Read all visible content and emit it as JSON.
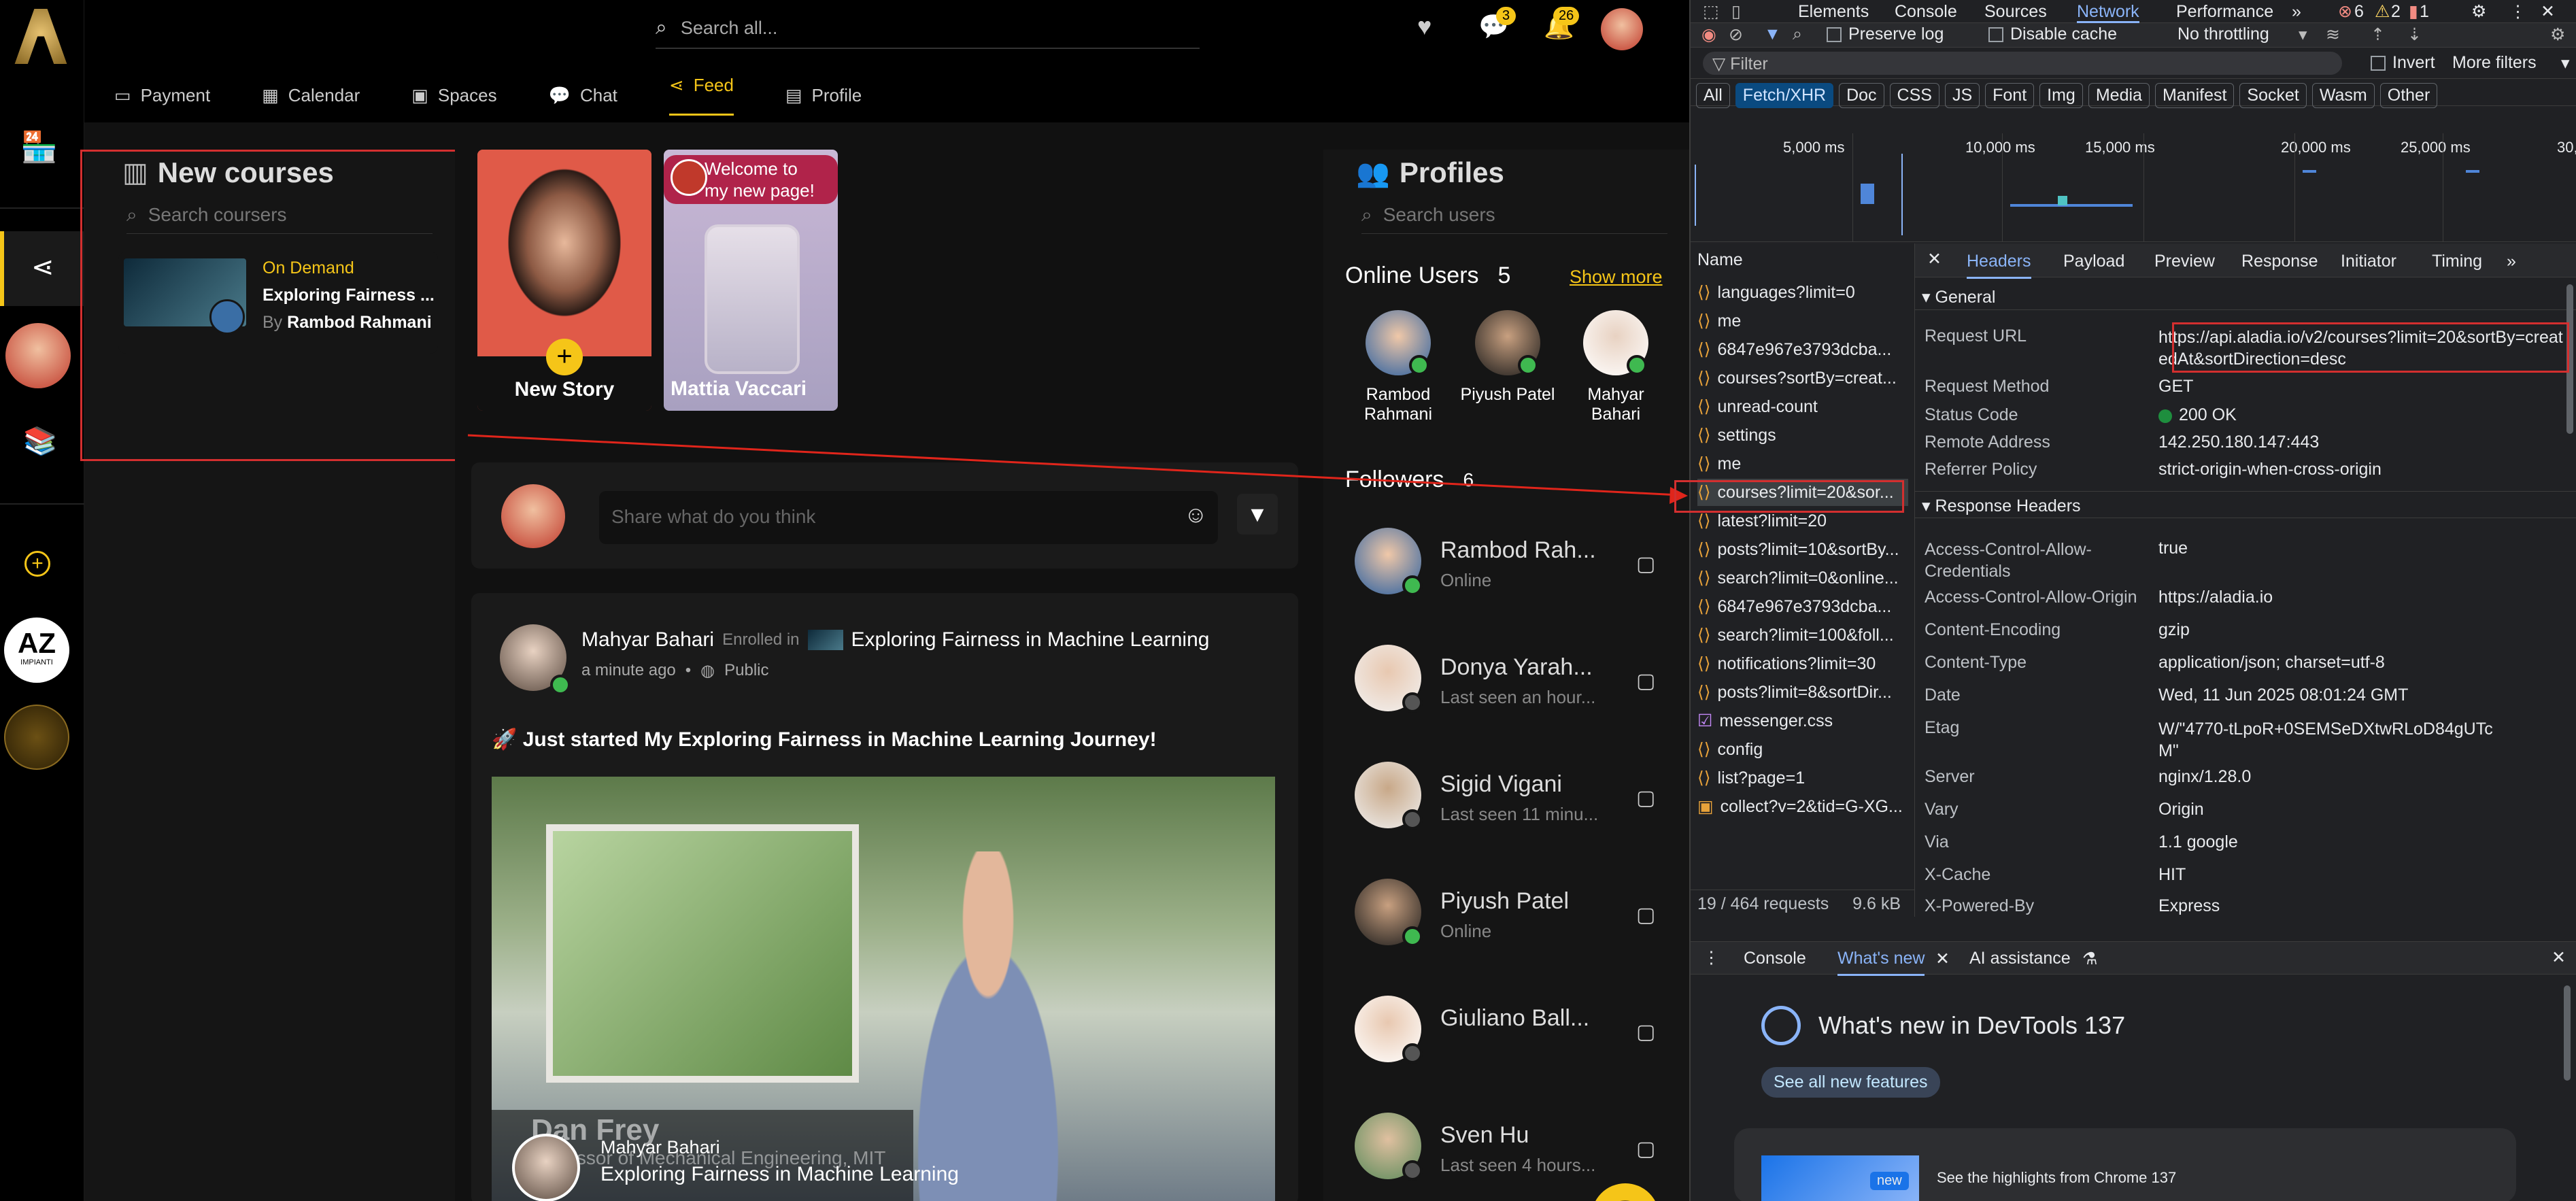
{
  "search": {
    "placeholder": "Search all..."
  },
  "header": {
    "messages_badge": "3",
    "notifications_badge": "26"
  },
  "nav": [
    {
      "label": "Payment"
    },
    {
      "label": "Calendar"
    },
    {
      "label": "Spaces"
    },
    {
      "label": "Chat"
    },
    {
      "label": "Feed"
    },
    {
      "label": "Profile"
    }
  ],
  "sidebar": {
    "az_logo": "AZ",
    "az_sub": "IMPIANTI"
  },
  "courses": {
    "title": "New courses",
    "search_placeholder": "Search coursers",
    "item": {
      "badge": "On Demand",
      "title": "Exploring Fairness ...",
      "by": "By",
      "author": "Rambod Rahmani"
    }
  },
  "stories": [
    {
      "label": "New Story"
    },
    {
      "label": "Mattia Vaccari",
      "caption": "Welcome to my new page!"
    }
  ],
  "composer": {
    "placeholder": "Share what do you think"
  },
  "post": {
    "author": "Mahyar Bahari",
    "enrolled": "Enrolled in",
    "course": "Exploring Fairness in Machine Learning",
    "time": "a minute ago",
    "visibility": "Public",
    "text": "🚀 Just started My Exploring Fairness in Machine Learning Journey!",
    "video_name": "Dan Frey",
    "video_sub": "Professor of Mechanical Engineering, MIT",
    "overlay_author": "Mahyar Bahari",
    "overlay_course": "Exploring Fairness in Machine Learning"
  },
  "profiles": {
    "title": "Profiles",
    "search_placeholder": "Search users",
    "online_label": "Online Users",
    "online_count": "5",
    "show_more": "Show more",
    "online_users": [
      {
        "first": "Rambod",
        "last": "Rahmani"
      },
      {
        "first": "Piyush Patel",
        "last": ""
      },
      {
        "first": "Mahyar",
        "last": "Bahari"
      }
    ],
    "followers_label": "Followers",
    "followers_count": "6",
    "followers": [
      {
        "name": "Rambod Rah...",
        "status": "Online",
        "online": true
      },
      {
        "name": "Donya Yarah...",
        "status": "Last seen an hour...",
        "online": false
      },
      {
        "name": "Sigid Vigani",
        "status": "Last seen 11 minu...",
        "online": false
      },
      {
        "name": "Piyush Patel",
        "status": "Online",
        "online": true
      },
      {
        "name": "Giuliano Ball...",
        "status": "",
        "online": false
      },
      {
        "name": "Sven Hu",
        "status": "Last seen 4 hours...",
        "online": false
      }
    ]
  },
  "devtools": {
    "tabs": [
      "Elements",
      "Console",
      "Sources",
      "Network",
      "Performance"
    ],
    "active_tab": "Network",
    "errors": "6",
    "warnings": "2",
    "info": "1",
    "toolbar": {
      "preserve_log": "Preserve log",
      "disable_cache": "Disable cache",
      "throttling": "No throttling"
    },
    "filter": {
      "placeholder": "Filter",
      "invert": "Invert",
      "more_filters": "More filters"
    },
    "types": [
      "All",
      "Fetch/XHR",
      "Doc",
      "CSS",
      "JS",
      "Font",
      "Img",
      "Media",
      "Manifest",
      "Socket",
      "Wasm",
      "Other"
    ],
    "active_type": "Fetch/XHR",
    "timeline_ticks": [
      "5,000 ms",
      "10,000 ms",
      "15,000 ms",
      "20,000 ms",
      "25,000 ms",
      "30,0"
    ],
    "name_header": "Name",
    "requests": [
      "languages?limit=0",
      "me",
      "6847e967e3793dcba...",
      "courses?sortBy=creat...",
      "unread-count",
      "settings",
      "me",
      "courses?limit=20&sor...",
      "latest?limit=20",
      "posts?limit=10&sortBy...",
      "search?limit=0&online...",
      "6847e967e3793dcba...",
      "search?limit=100&foll...",
      "notifications?limit=30",
      "posts?limit=8&sortDir...",
      "messenger.css",
      "config",
      "list?page=1",
      "collect?v=2&tid=G-XG..."
    ],
    "summary": {
      "requests": "19 / 464 requests",
      "size": "9.6 kB"
    },
    "detail_tabs": [
      "Headers",
      "Payload",
      "Preview",
      "Response",
      "Initiator",
      "Timing"
    ],
    "general": {
      "title": "General",
      "rows": [
        {
          "name": "Request URL",
          "value": "https://api.aladia.io/v2/courses?limit=20&sortBy=createdAt&sortDirection=desc"
        },
        {
          "name": "Request Method",
          "value": "GET"
        },
        {
          "name": "Status Code",
          "value": "200 OK"
        },
        {
          "name": "Remote Address",
          "value": "142.250.180.147:443"
        },
        {
          "name": "Referrer Policy",
          "value": "strict-origin-when-cross-origin"
        }
      ]
    },
    "response_headers": {
      "title": "Response Headers",
      "rows": [
        {
          "name": "Access-Control-Allow-Credentials",
          "value": "true"
        },
        {
          "name": "Access-Control-Allow-Origin",
          "value": "https://aladia.io"
        },
        {
          "name": "Content-Encoding",
          "value": "gzip"
        },
        {
          "name": "Content-Type",
          "value": "application/json; charset=utf-8"
        },
        {
          "name": "Date",
          "value": "Wed, 11 Jun 2025 08:01:24 GMT"
        },
        {
          "name": "Etag",
          "value": "W/\"4770-tLpoR+0SEMSeDXtwRLoD84gUTcM\""
        },
        {
          "name": "Server",
          "value": "nginx/1.28.0"
        },
        {
          "name": "Vary",
          "value": "Origin"
        },
        {
          "name": "Via",
          "value": "1.1 google"
        },
        {
          "name": "X-Cache",
          "value": "HIT"
        },
        {
          "name": "X-Powered-By",
          "value": "Express"
        }
      ]
    },
    "drawer": {
      "tabs": [
        "Console",
        "What's new",
        "AI assistance"
      ],
      "whats_new_title": "What's new in DevTools 137",
      "see_all": "See all new features",
      "highlights": "See the highlights from Chrome 137",
      "new_badge": "new"
    }
  }
}
